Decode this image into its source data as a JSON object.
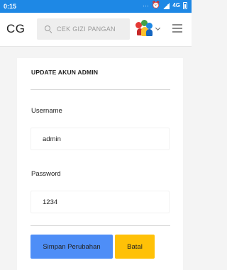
{
  "status_bar": {
    "time": "0:15",
    "network_label": "4G"
  },
  "app_bar": {
    "logo": "CG",
    "search_placeholder": "CEK GIZI PANGAN"
  },
  "form": {
    "title": "UPDATE AKUN ADMIN",
    "username_label": "Username",
    "username_value": "admin",
    "password_label": "Password",
    "password_value": "1234",
    "save_label": "Simpan Perubahan",
    "cancel_label": "Batal"
  },
  "colors": {
    "status_bar": "#1e88e5",
    "save_button": "#4e8ef7",
    "cancel_button": "#ffc107"
  }
}
